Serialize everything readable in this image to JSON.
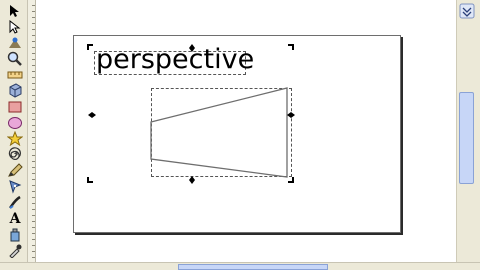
{
  "canvas": {
    "text_object": "perspective"
  },
  "toolbox": {
    "tools": [
      {
        "icon": "selector-arrow-icon"
      },
      {
        "icon": "node-editor-icon"
      },
      {
        "icon": "tweak-icon"
      },
      {
        "icon": "zoom-icon"
      },
      {
        "icon": "rectangle-icon"
      },
      {
        "icon": "3d-box-icon"
      },
      {
        "icon": "ellipse-icon"
      },
      {
        "icon": "star-icon"
      },
      {
        "icon": "spiral-icon"
      },
      {
        "icon": "pencil-icon"
      },
      {
        "icon": "pen-icon"
      },
      {
        "icon": "calligraphy-icon"
      },
      {
        "icon": "text-icon",
        "glyph": "A"
      },
      {
        "icon": "spray-icon"
      },
      {
        "icon": "eraser-icon"
      },
      {
        "icon": "dropper-icon"
      }
    ]
  }
}
